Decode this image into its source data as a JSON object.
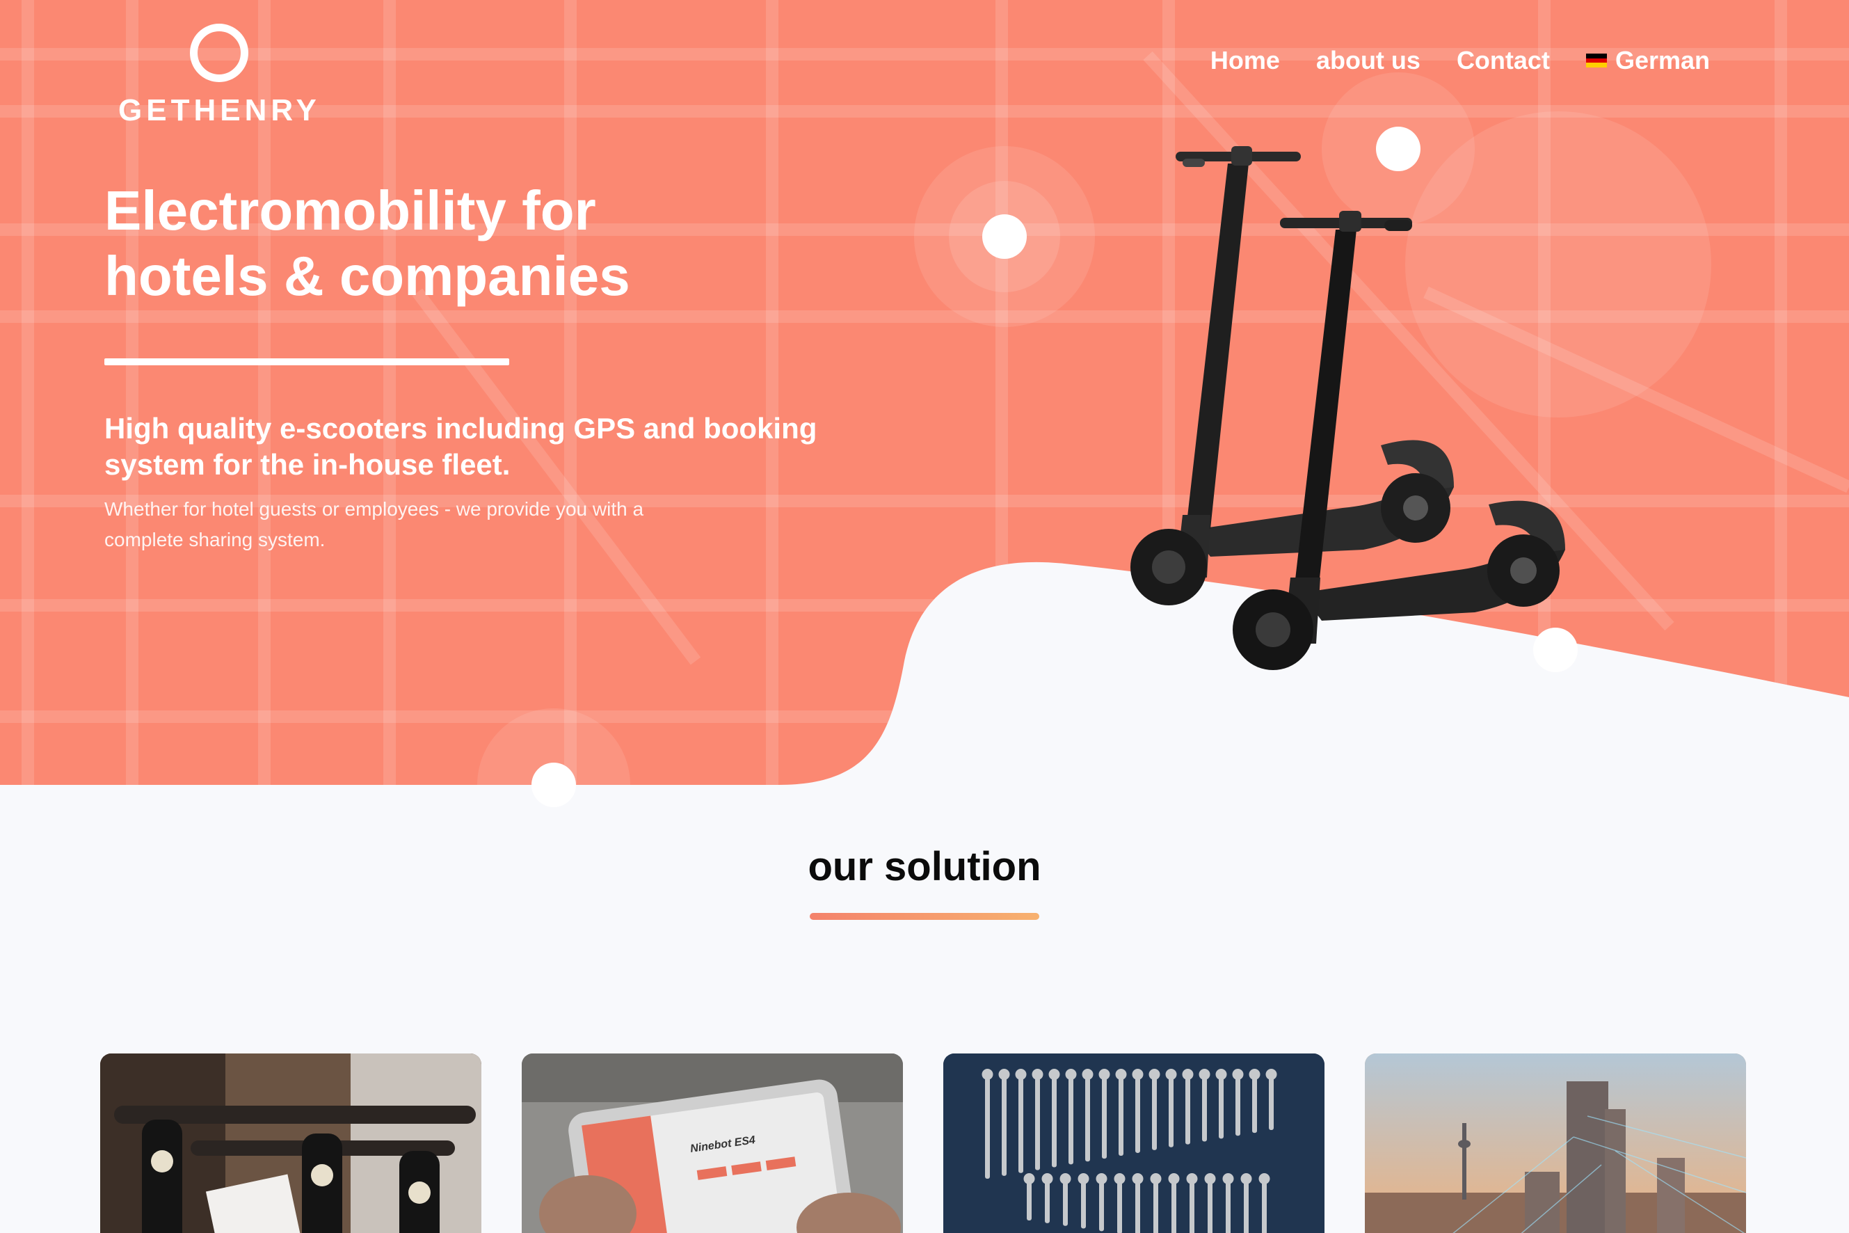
{
  "brand": {
    "name": "GETHENRY"
  },
  "nav": {
    "items": [
      {
        "label": "Home"
      },
      {
        "label": "about us"
      },
      {
        "label": "Contact"
      }
    ],
    "language": "German"
  },
  "hero": {
    "headline_line1": "Electromobility for",
    "headline_line2": "hotels & companies",
    "subheadline": "High quality e-scooters including GPS and booking system for the in-house fleet.",
    "body": "Whether for hotel guests or employees - we provide you with a complete sharing system."
  },
  "solution": {
    "title": "our solution",
    "cards": [
      {
        "image": "branded-scooter-handlebars-photo"
      },
      {
        "image": "tablet-booking-app-photo",
        "screen_title": "Ninebot ES4"
      },
      {
        "image": "tool-wall-wrenches-photo"
      },
      {
        "image": "city-skyline-network-photo"
      }
    ]
  },
  "colors": {
    "hero": "#fb8872",
    "page_background": "#f8f9fc",
    "text_dark": "#0b0b0b",
    "accent_gradient_start": "#f4826b",
    "accent_gradient_end": "#f7b16f"
  },
  "icons": {
    "logo": "ring-logo-icon",
    "language_flag": "german-flag-icon",
    "product": "e-scooter-pair-illustration"
  }
}
